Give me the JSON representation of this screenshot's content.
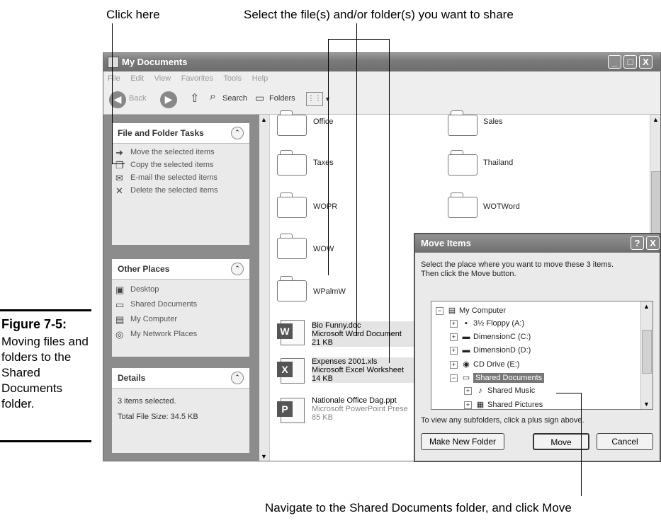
{
  "callouts": {
    "click_here": "Click here",
    "select_files": "Select the file(s) and/or folder(s) you want to share",
    "navigate": "Navigate to the Shared Documents folder, and click Move"
  },
  "figure": {
    "number": "Figure 7-5:",
    "caption": "Moving files and folders to the Shared Documents folder."
  },
  "window": {
    "title": "My Documents",
    "menu": [
      "File",
      "Edit",
      "View",
      "Favorites",
      "Tools",
      "Help"
    ],
    "toolbar": {
      "back": "Back",
      "search": "Search",
      "folders": "Folders"
    },
    "controls": {
      "minimize": "_",
      "maximize": "□",
      "close": "X"
    }
  },
  "task_pane": {
    "file_folder_tasks": {
      "title": "File and Folder Tasks",
      "items": [
        "Move the selected items",
        "Copy the selected items",
        "E-mail the selected items",
        "Delete the selected items"
      ]
    },
    "other_places": {
      "title": "Other Places",
      "items": [
        "Desktop",
        "Shared Documents",
        "My Computer",
        "My Network Places"
      ]
    },
    "details": {
      "title": "Details",
      "selected": "3 items selected.",
      "size": "Total File Size: 34.5 KB"
    }
  },
  "folders": [
    "Office",
    "Sales",
    "Taxes",
    "Thailand",
    "WOPR",
    "WOTWord",
    "WOW",
    "WPalmW"
  ],
  "files": [
    {
      "name": "Bio Funny.doc",
      "type": "Microsoft Word Document",
      "size": "21 KB",
      "badge": "W"
    },
    {
      "name": "Expenses 2001.xls",
      "type": "Microsoft Excel Worksheet",
      "size": "14 KB",
      "badge": "X"
    },
    {
      "name": "Nationale Office Dag.ppt",
      "type": "Microsoft PowerPoint Prese",
      "size": "85 KB",
      "badge": "P"
    }
  ],
  "dialog": {
    "title": "Move Items",
    "help": "?",
    "close": "X",
    "instruction_1": "Select the place where you want to move these 3 items.",
    "instruction_2": "Then click the Move button.",
    "tree": [
      {
        "label": "My Computer",
        "toggle": "−"
      },
      {
        "label": "3½ Floppy (A:)",
        "toggle": "+"
      },
      {
        "label": "DimensionC (C:)",
        "toggle": "+"
      },
      {
        "label": "DimensionD (D:)",
        "toggle": "+"
      },
      {
        "label": "CD Drive (E:)",
        "toggle": "+"
      },
      {
        "label": "Shared Documents",
        "toggle": "−"
      },
      {
        "label": "Shared Music",
        "toggle": "+"
      },
      {
        "label": "Shared Pictures",
        "toggle": "+"
      }
    ],
    "hint": "To view any subfolders, click a plus sign above.",
    "buttons": {
      "new_folder": "Make New Folder",
      "move": "Move",
      "cancel": "Cancel"
    }
  }
}
